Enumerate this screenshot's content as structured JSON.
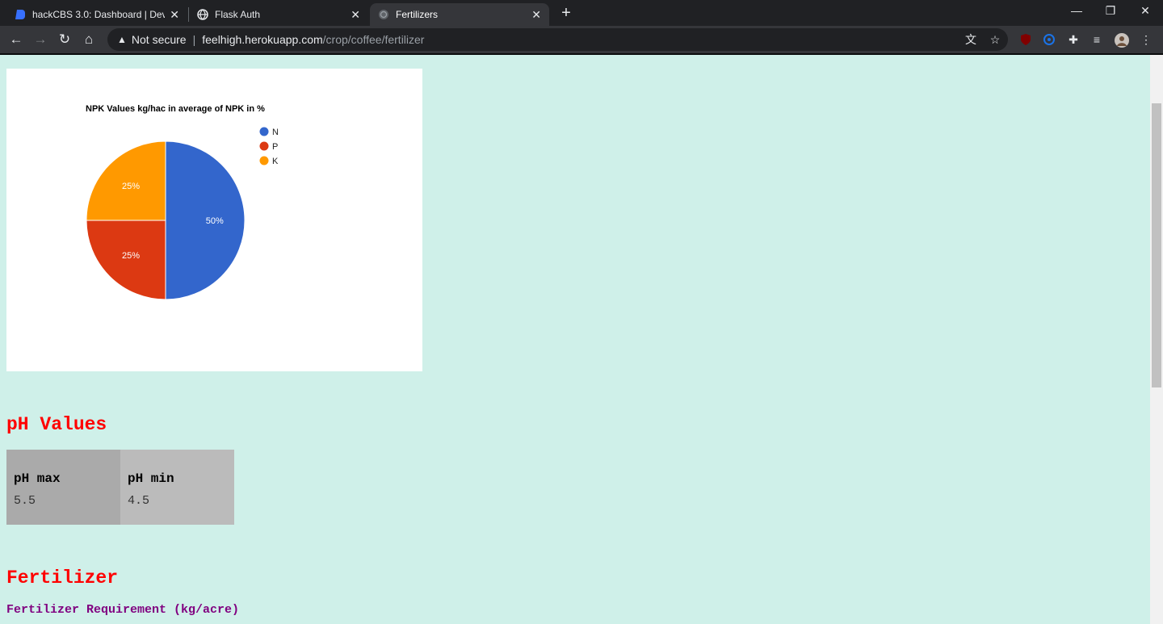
{
  "browser": {
    "tabs": [
      {
        "title": "hackCBS 3.0: Dashboard | Devfolio",
        "active": false,
        "favicon": "devfolio-icon"
      },
      {
        "title": "Flask Auth",
        "active": false,
        "favicon": "globe-icon"
      },
      {
        "title": "Fertilizers",
        "active": true,
        "favicon": "loading-globe-icon"
      }
    ],
    "security_label": "Not secure",
    "url_host": "feelhigh.herokuapp.com",
    "url_path": "/crop/coffee/fertilizer"
  },
  "chart_data": {
    "type": "pie",
    "title": "NPK Values kg/hac in average of NPK in %",
    "slices": [
      {
        "label": "N",
        "value": 50,
        "color": "#3366cc"
      },
      {
        "label": "P",
        "value": 25,
        "color": "#dc3912"
      },
      {
        "label": "K",
        "value": 25,
        "color": "#ff9900"
      }
    ],
    "legend_position": "right"
  },
  "ph": {
    "heading": "pH Values",
    "max_label": "pH max",
    "min_label": "pH min",
    "max_value": "5.5",
    "min_value": "4.5"
  },
  "fertilizer": {
    "heading": "Fertilizer",
    "requirement_label": "Fertilizer Requirement (kg/acre)"
  }
}
